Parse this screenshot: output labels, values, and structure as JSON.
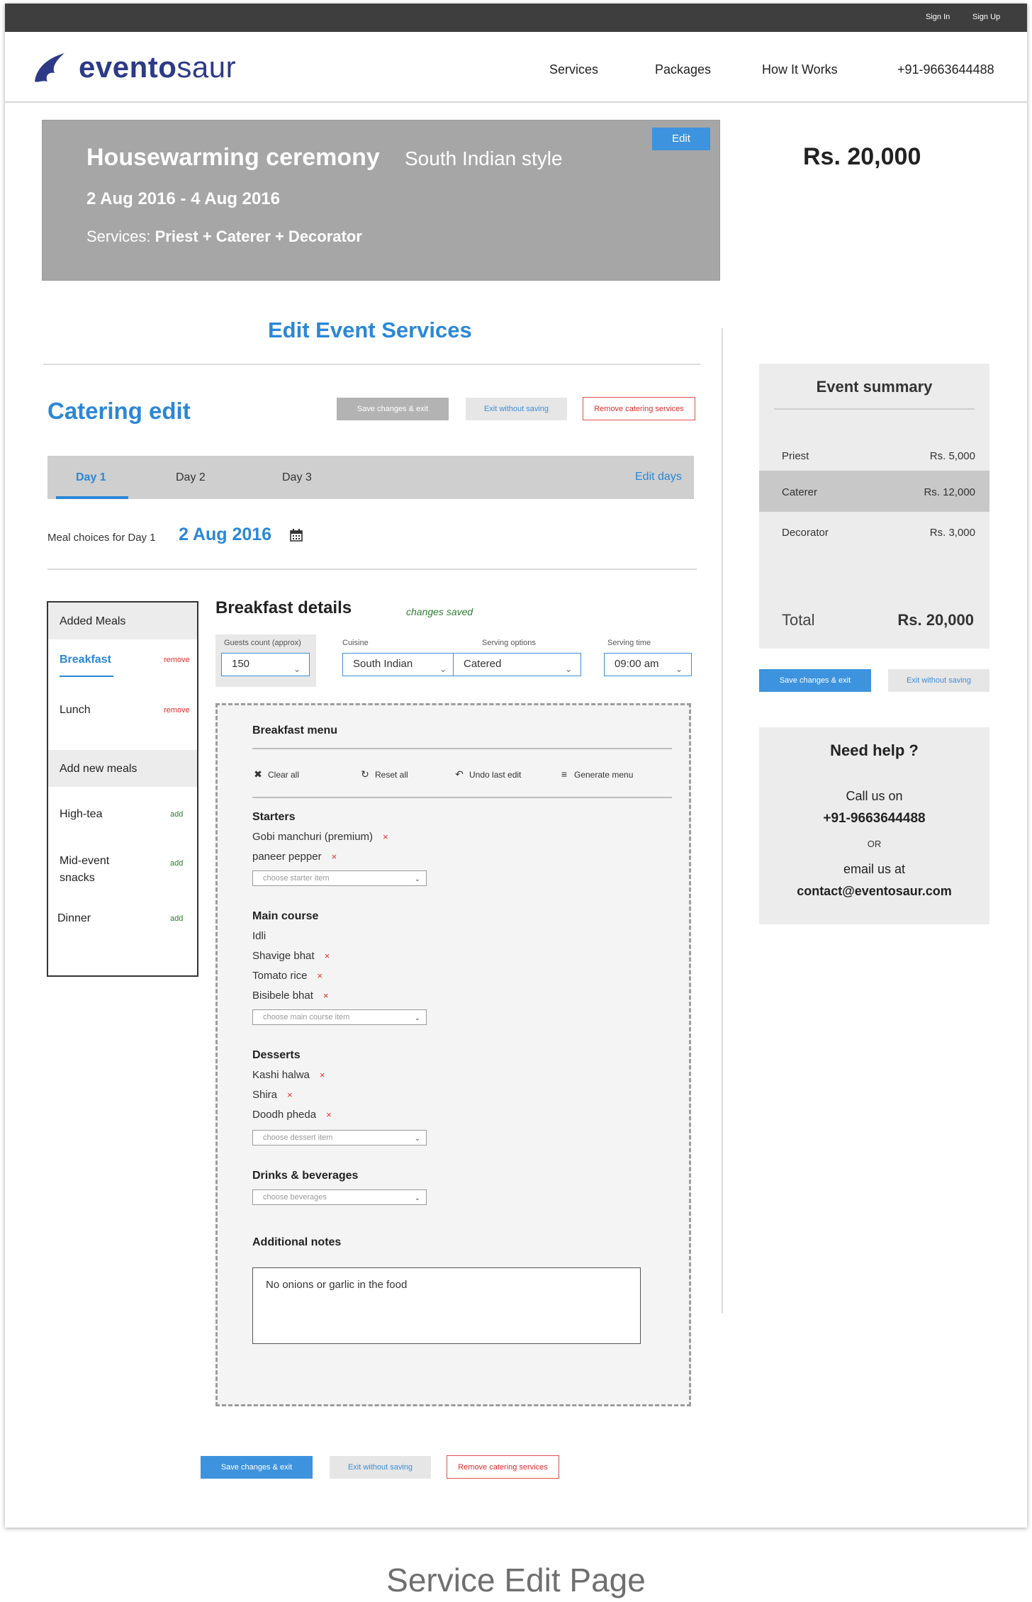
{
  "topbar": {
    "sign_in": "Sign In",
    "sign_up": "Sign Up"
  },
  "brand": {
    "name_bold": "evento",
    "name_light": "saur",
    "color": "#2d3a86"
  },
  "nav": {
    "services": "Services",
    "packages": "Packages",
    "how_it_works": "How It Works",
    "phone": "+91-9663644488"
  },
  "hero": {
    "title": "Housewarming ceremony",
    "style": "South Indian style",
    "dates": "2 Aug 2016 - 4 Aug 2016",
    "services_prefix": "Services: ",
    "services_value": "Priest + Caterer + Decorator",
    "edit_label": "Edit"
  },
  "price_total": "Rs. 20,000",
  "page_section_title": "Edit Event Services",
  "catering": {
    "title": "Catering edit",
    "save_exit": "Save changes & exit",
    "exit_no_save": "Exit without saving",
    "remove_services": "Remove catering services"
  },
  "days": {
    "tabs": [
      "Day 1",
      "Day 2",
      "Day 3"
    ],
    "active": "Day 1",
    "edit_days": "Edit days"
  },
  "meal_choices": {
    "label": "Meal choices for Day 1",
    "date": "2 Aug 2016"
  },
  "sidebar": {
    "added_heading": "Added Meals",
    "added": [
      {
        "name": "Breakfast",
        "action": "remove"
      },
      {
        "name": "Lunch",
        "action": "remove"
      }
    ],
    "new_heading": "Add new meals",
    "new": [
      {
        "name": "High-tea",
        "action": "add"
      },
      {
        "name": "Mid-event snacks",
        "line1": "Mid-event",
        "line2": "snacks",
        "action": "add"
      },
      {
        "name": "Dinner",
        "action": "add"
      }
    ]
  },
  "details": {
    "title": "Breakfast details",
    "status": "changes saved",
    "guests_label": "Guests count (approx)",
    "guests_value": "150",
    "cuisine_label": "Cuisine",
    "cuisine_value": "South Indian",
    "serving_label": "Serving options",
    "serving_value": "Catered",
    "time_label": "Serving time",
    "time_value": "09:00 am"
  },
  "menu": {
    "title": "Breakfast menu",
    "tools": {
      "clear": "Clear all",
      "reset": "Reset all",
      "undo": "Undo last edit",
      "generate": "Generate menu"
    },
    "starters": {
      "label": "Starters",
      "items": [
        "Gobi manchuri (premium)",
        "paneer pepper"
      ],
      "placeholder": "choose starter item"
    },
    "main_course": {
      "label": "Main course",
      "items": [
        "Idli",
        "Shavige bhat",
        "Tomato rice",
        "Bisibele bhat"
      ],
      "placeholder": "choose main course item"
    },
    "desserts": {
      "label": "Desserts",
      "items": [
        "Kashi halwa",
        "Shira",
        "Doodh pheda"
      ],
      "placeholder": "choose dessert item"
    },
    "drinks": {
      "label": "Drinks & beverages",
      "placeholder": "choose beverages"
    },
    "notes": {
      "label": "Additional notes",
      "value": "No onions or garlic in the food"
    },
    "remove_mark": "×"
  },
  "bottom_buttons": {
    "save_exit": "Save changes & exit",
    "exit_no_save": "Exit without saving",
    "remove_services": "Remove catering services"
  },
  "summary": {
    "title": "Event summary",
    "rows": [
      {
        "name": "Priest",
        "value": "Rs. 5,000"
      },
      {
        "name": "Caterer",
        "value": "Rs. 12,000"
      },
      {
        "name": "Decorator",
        "value": "Rs. 3,000"
      }
    ],
    "total_label": "Total",
    "total_value": "Rs. 20,000",
    "save_exit": "Save changes & exit",
    "exit_no_save": "Exit without saving"
  },
  "help": {
    "title": "Need help ?",
    "call_label": "Call us on",
    "phone": "+91-9663644488",
    "or": "OR",
    "email_label": "email us at",
    "email": "contact@eventosaur.com"
  },
  "caption": "Service Edit Page",
  "colors": {
    "accent": "#2b87d6",
    "danger": "#e02d2d",
    "success": "#2e7d32",
    "hero_bg": "#a6a6a6"
  }
}
